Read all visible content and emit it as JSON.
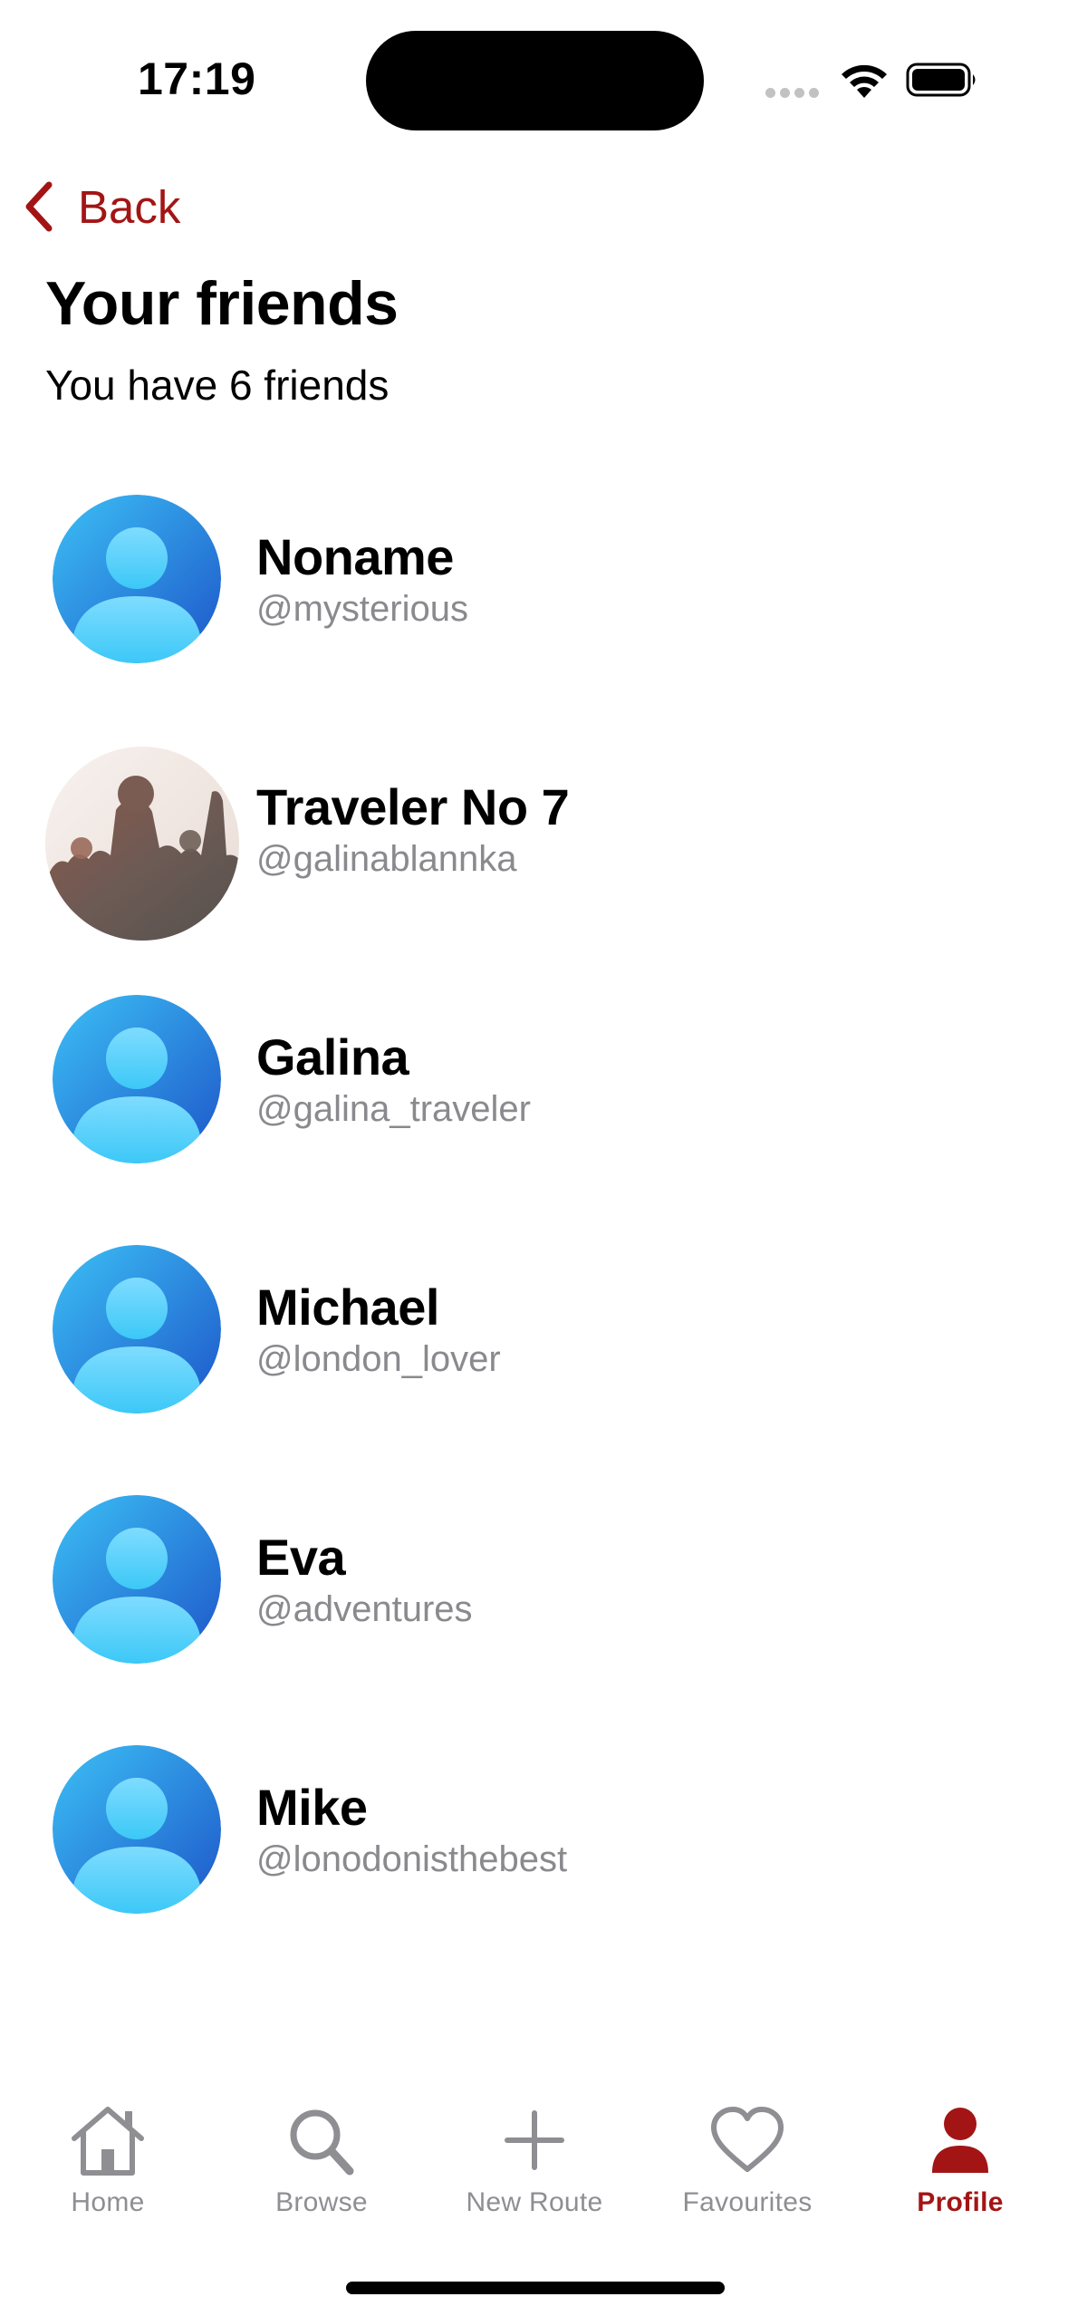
{
  "status_bar": {
    "time": "17:19",
    "icons": [
      "signal-dots-icon",
      "wifi-icon",
      "battery-icon"
    ]
  },
  "nav": {
    "back_label": "Back",
    "back_icon": "chevron-left-icon",
    "accent_color": "#A31515"
  },
  "page": {
    "title": "Your friends",
    "count_prefix": "You have ",
    "count": "6",
    "count_suffix": " friends"
  },
  "friends": [
    {
      "name": "Noname",
      "handle": "@mysterious",
      "avatar": "default-person-avatar"
    },
    {
      "name": "Traveler No 7",
      "handle": "@galinablannka",
      "avatar": "crowd-photo-avatar"
    },
    {
      "name": "Galina",
      "handle": "@galina_traveler",
      "avatar": "default-person-avatar"
    },
    {
      "name": "Michael",
      "handle": "@london_lover",
      "avatar": "default-person-avatar"
    },
    {
      "name": "Eva",
      "handle": "@adventures",
      "avatar": "default-person-avatar"
    },
    {
      "name": "Mike",
      "handle": "@lonodonisthebest",
      "avatar": "default-person-avatar"
    }
  ],
  "tab_bar": {
    "tabs": [
      {
        "label": "Home",
        "icon": "house-icon",
        "active": false
      },
      {
        "label": "Browse",
        "icon": "magnifying-glass-icon",
        "active": false
      },
      {
        "label": "New Route",
        "icon": "plus-icon",
        "active": false
      },
      {
        "label": "Favourites",
        "icon": "heart-icon",
        "active": false
      },
      {
        "label": "Profile",
        "icon": "person-icon",
        "active": true
      }
    ],
    "inactive_color": "#8E8E93",
    "active_color": "#A31515"
  }
}
